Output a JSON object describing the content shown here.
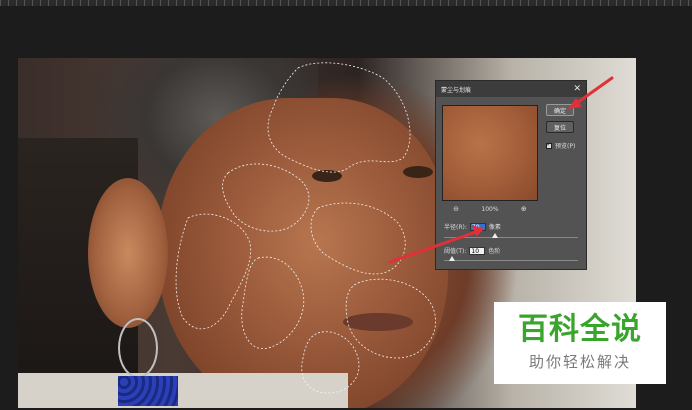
{
  "dialog": {
    "title": "蒙尘与划痕",
    "ok_label": "确定",
    "reset_label": "复位",
    "preview_label": "预览(P)",
    "zoom_level": "100%",
    "radius": {
      "label": "半径(R):",
      "value": "70",
      "unit": "像素",
      "slider_fraction": 0.38
    },
    "threshold": {
      "label": "阈值(T):",
      "value": "10",
      "unit": "色阶",
      "slider_fraction": 0.06
    }
  },
  "watermark": {
    "title": "百科全说",
    "subtitle": "助你轻松解决"
  },
  "colors": {
    "annotation_arrow": "#e0303a",
    "watermark_green": "#3aa52c",
    "dialog_bg": "#535353",
    "selected_input": "#3b6fc7"
  }
}
